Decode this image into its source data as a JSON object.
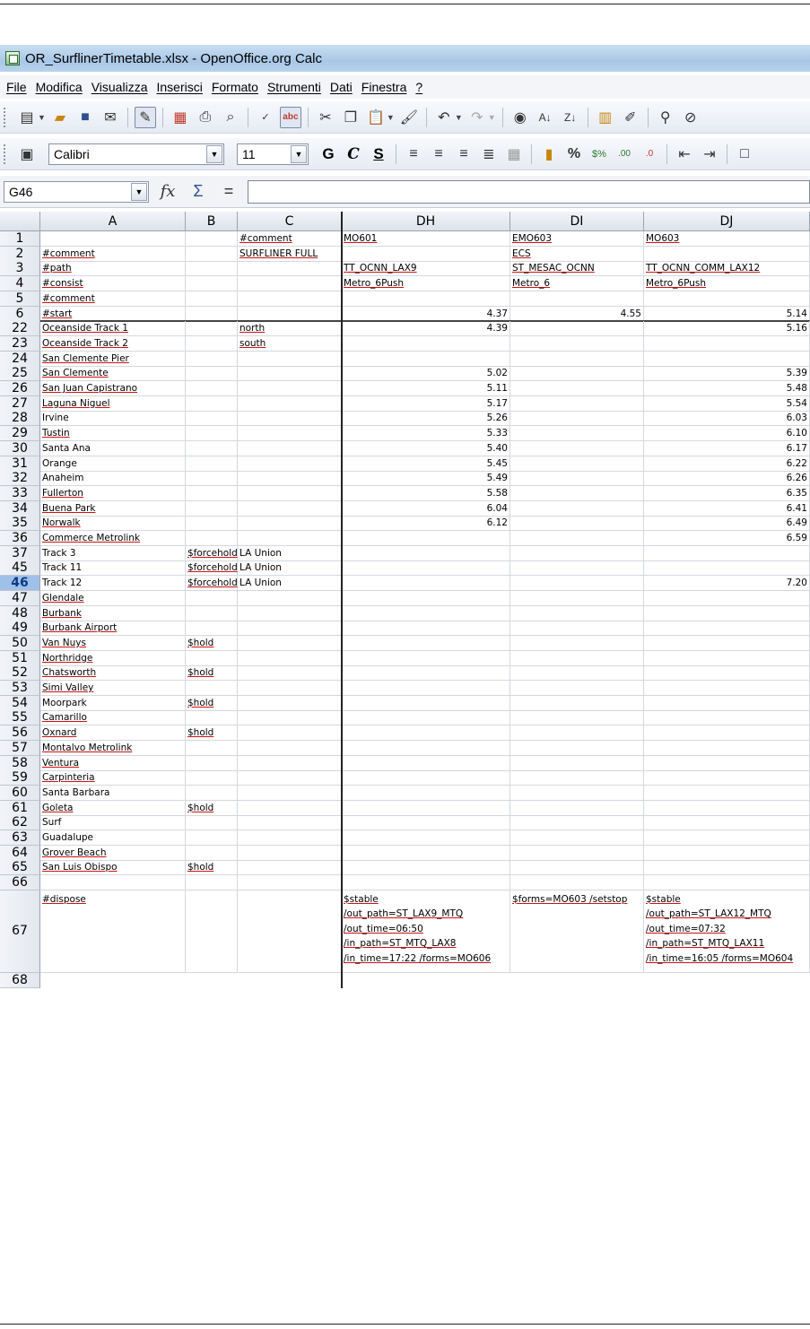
{
  "window": {
    "title": "OR_SurflinerTimetable.xlsx - OpenOffice.org Calc"
  },
  "menu": [
    "File",
    "Modifica",
    "Visualizza",
    "Inserisci",
    "Formato",
    "Strumenti",
    "Dati",
    "Finestra",
    "?"
  ],
  "toolbar_icons": [
    "new-icon",
    "open-icon",
    "save-icon",
    "email-icon",
    "edit-mode-icon",
    "export-pdf-icon",
    "print-icon",
    "page-preview-icon",
    "spellcheck-icon",
    "autospellcheck-icon",
    "cut-icon",
    "copy-icon",
    "paste-icon",
    "clone-format-icon",
    "undo-icon",
    "redo-icon",
    "hyperlink-icon",
    "sort-ascending-icon",
    "sort-descending-icon",
    "chart-icon",
    "draw-icon",
    "find-icon",
    "navigator-icon"
  ],
  "format": {
    "font": "Calibri",
    "size": "11",
    "bold": "G",
    "italic": "C",
    "underline": "S"
  },
  "formula_bar": {
    "cell_ref": "G46",
    "value": ""
  },
  "columns": [
    "A",
    "B",
    "C",
    "DH",
    "DI",
    "DJ"
  ],
  "rows": [
    {
      "n": "1",
      "a": "",
      "b": "",
      "c": "#comment",
      "dh": "MO601",
      "di": "EMO603",
      "dj": "MO603"
    },
    {
      "n": "2",
      "a": "#comment",
      "b": "",
      "c": "SURFLINER FULL",
      "dh": "",
      "di": "ECS",
      "dj": ""
    },
    {
      "n": "3",
      "a": "#path",
      "b": "",
      "c": "",
      "dh": "TT_OCNN_LAX9",
      "di": "ST_MESAC_OCNN",
      "dj": "TT_OCNN_COMM_LAX12"
    },
    {
      "n": "4",
      "a": "#consist",
      "b": "",
      "c": "",
      "dh": "Metro_6Push",
      "di": "Metro_6",
      "dj": "Metro_6Push"
    },
    {
      "n": "5",
      "a": "#comment",
      "b": "",
      "c": "",
      "dh": "",
      "di": "",
      "dj": ""
    },
    {
      "n": "6",
      "a": "#start",
      "b": "",
      "c": "",
      "dh": "4.37",
      "di": "4.55",
      "dj": "5.14"
    },
    {
      "n": "22",
      "a": "Oceanside Track 1",
      "b": "",
      "c": "north",
      "dh": "4.39",
      "di": "",
      "dj": "5.16"
    },
    {
      "n": "23",
      "a": "Oceanside Track 2",
      "b": "",
      "c": "south",
      "dh": "",
      "di": "",
      "dj": ""
    },
    {
      "n": "24",
      "a": "San Clemente Pier",
      "b": "",
      "c": "",
      "dh": "",
      "di": "",
      "dj": ""
    },
    {
      "n": "25",
      "a": "San Clemente",
      "b": "",
      "c": "",
      "dh": "5.02",
      "di": "",
      "dj": "5.39"
    },
    {
      "n": "26",
      "a": "San Juan Capistrano",
      "b": "",
      "c": "",
      "dh": "5.11",
      "di": "",
      "dj": "5.48"
    },
    {
      "n": "27",
      "a": "Laguna Niguel",
      "b": "",
      "c": "",
      "dh": "5.17",
      "di": "",
      "dj": "5.54"
    },
    {
      "n": "28",
      "a": "Irvine",
      "b": "",
      "c": "",
      "dh": "5.26",
      "di": "",
      "dj": "6.03"
    },
    {
      "n": "29",
      "a": "Tustin",
      "b": "",
      "c": "",
      "dh": "5.33",
      "di": "",
      "dj": "6.10"
    },
    {
      "n": "30",
      "a": "Santa Ana",
      "b": "",
      "c": "",
      "dh": "5.40",
      "di": "",
      "dj": "6.17"
    },
    {
      "n": "31",
      "a": "Orange",
      "b": "",
      "c": "",
      "dh": "5.45",
      "di": "",
      "dj": "6.22"
    },
    {
      "n": "32",
      "a": "Anaheim",
      "b": "",
      "c": "",
      "dh": "5.49",
      "di": "",
      "dj": "6.26"
    },
    {
      "n": "33",
      "a": "Fullerton",
      "b": "",
      "c": "",
      "dh": "5.58",
      "di": "",
      "dj": "6.35"
    },
    {
      "n": "34",
      "a": "Buena Park",
      "b": "",
      "c": "",
      "dh": "6.04",
      "di": "",
      "dj": "6.41"
    },
    {
      "n": "35",
      "a": "Norwalk",
      "b": "",
      "c": "",
      "dh": "6.12",
      "di": "",
      "dj": "6.49"
    },
    {
      "n": "36",
      "a": "Commerce Metrolink",
      "b": "",
      "c": "",
      "dh": "",
      "di": "",
      "dj": "6.59"
    },
    {
      "n": "37",
      "a": "Track 3",
      "b": "$forcehold",
      "c": "LA Union",
      "dh": "",
      "di": "",
      "dj": ""
    },
    {
      "n": "45",
      "a": "Track 11",
      "b": "$forcehold",
      "c": "LA Union",
      "dh": "",
      "di": "",
      "dj": ""
    },
    {
      "n": "46",
      "a": "Track 12",
      "b": "$forcehold",
      "c": "LA Union",
      "dh": "",
      "di": "",
      "dj": "7.20"
    },
    {
      "n": "47",
      "a": "Glendale",
      "b": "",
      "c": "",
      "dh": "",
      "di": "",
      "dj": ""
    },
    {
      "n": "48",
      "a": "Burbank",
      "b": "",
      "c": "",
      "dh": "",
      "di": "",
      "dj": ""
    },
    {
      "n": "49",
      "a": "Burbank Airport",
      "b": "",
      "c": "",
      "dh": "",
      "di": "",
      "dj": ""
    },
    {
      "n": "50",
      "a": "Van Nuys",
      "b": "$hold",
      "c": "",
      "dh": "",
      "di": "",
      "dj": ""
    },
    {
      "n": "51",
      "a": "Northridge",
      "b": "",
      "c": "",
      "dh": "",
      "di": "",
      "dj": ""
    },
    {
      "n": "52",
      "a": "Chatsworth",
      "b": "$hold",
      "c": "",
      "dh": "",
      "di": "",
      "dj": ""
    },
    {
      "n": "53",
      "a": "Simi Valley",
      "b": "",
      "c": "",
      "dh": "",
      "di": "",
      "dj": ""
    },
    {
      "n": "54",
      "a": "Moorpark",
      "b": "$hold",
      "c": "",
      "dh": "",
      "di": "",
      "dj": ""
    },
    {
      "n": "55",
      "a": "Camarillo",
      "b": "",
      "c": "",
      "dh": "",
      "di": "",
      "dj": ""
    },
    {
      "n": "56",
      "a": "Oxnard",
      "b": "$hold",
      "c": "",
      "dh": "",
      "di": "",
      "dj": ""
    },
    {
      "n": "57",
      "a": "Montalvo Metrolink",
      "b": "",
      "c": "",
      "dh": "",
      "di": "",
      "dj": ""
    },
    {
      "n": "58",
      "a": "Ventura",
      "b": "",
      "c": "",
      "dh": "",
      "di": "",
      "dj": ""
    },
    {
      "n": "59",
      "a": "Carpinteria",
      "b": "",
      "c": "",
      "dh": "",
      "di": "",
      "dj": ""
    },
    {
      "n": "60",
      "a": "Santa Barbara",
      "b": "",
      "c": "",
      "dh": "",
      "di": "",
      "dj": ""
    },
    {
      "n": "61",
      "a": "Goleta",
      "b": "$hold",
      "c": "",
      "dh": "",
      "di": "",
      "dj": ""
    },
    {
      "n": "62",
      "a": "Surf",
      "b": "",
      "c": "",
      "dh": "",
      "di": "",
      "dj": ""
    },
    {
      "n": "63",
      "a": "Guadalupe",
      "b": "",
      "c": "",
      "dh": "",
      "di": "",
      "dj": ""
    },
    {
      "n": "64",
      "a": "Grover Beach",
      "b": "",
      "c": "",
      "dh": "",
      "di": "",
      "dj": ""
    },
    {
      "n": "65",
      "a": "San Luis Obispo",
      "b": "$hold",
      "c": "",
      "dh": "",
      "di": "",
      "dj": ""
    },
    {
      "n": "66",
      "a": "",
      "b": "",
      "c": "",
      "dh": "",
      "di": "",
      "dj": ""
    }
  ],
  "row67": {
    "n": "67",
    "a": "#dispose",
    "dh": [
      "$stable",
      "/out_path=ST_LAX9_MTQ",
      "/out_time=06:50",
      "/in_path=ST_MTQ_LAX8",
      "/in_time=17:22 /forms=MO606"
    ],
    "di": [
      "$forms=MO603 /setstop"
    ],
    "dj": [
      "$stable",
      "/out_path=ST_LAX12_MTQ",
      "/out_time=07:32",
      "/in_path=ST_MTQ_LAX11",
      "/in_time=16:05 /forms=MO604"
    ]
  },
  "row68": {
    "n": "68"
  },
  "selected_row": "46"
}
